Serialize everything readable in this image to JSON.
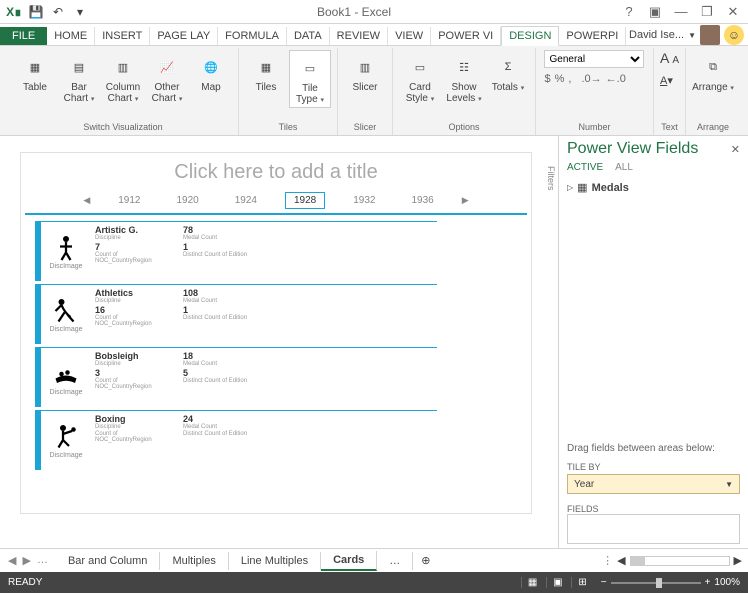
{
  "window": {
    "title": "Book1 - Excel"
  },
  "tabs": {
    "file": "FILE",
    "items": [
      "HOME",
      "INSERT",
      "PAGE LAY",
      "FORMULA",
      "DATA",
      "REVIEW",
      "VIEW",
      "POWER VI",
      "DESIGN",
      "POWERPI"
    ],
    "active": "DESIGN",
    "user": "David Ise..."
  },
  "ribbon": {
    "switchVis": {
      "label": "Switch Visualization",
      "btns": [
        "Table",
        "Bar Chart",
        "Column Chart",
        "Other Chart",
        "Map"
      ]
    },
    "tiles": {
      "label": "Tiles",
      "btns": [
        "Tiles",
        "Tile Type"
      ]
    },
    "slicer": {
      "label": "Slicer",
      "btn": "Slicer"
    },
    "options": {
      "label": "Options",
      "btns": [
        "Card Style",
        "Show Levels",
        "Totals"
      ]
    },
    "number": {
      "label": "Number",
      "format": "General"
    },
    "text": {
      "label": "Text"
    },
    "arrange": {
      "label": "Arrange",
      "btn": "Arrange"
    }
  },
  "canvas": {
    "titlePlaceholder": "Click here to add a title",
    "years": [
      "1912",
      "1920",
      "1924",
      "1928",
      "1932",
      "1936"
    ],
    "selectedYear": "1928",
    "filters": "Filters",
    "cards": [
      {
        "disc": "Artistic G.",
        "medal": "78",
        "noc": "7",
        "ed": "1"
      },
      {
        "disc": "Athletics",
        "medal": "108",
        "noc": "16",
        "ed": "1"
      },
      {
        "disc": "Bobsleigh",
        "medal": "18",
        "noc": "3",
        "ed": "5"
      },
      {
        "disc": "Boxing",
        "medal": "24",
        "noc": "",
        "ed": ""
      }
    ],
    "labels": {
      "disc": "Discipline",
      "medal": "Medal Count",
      "noc": "Count of NOC_CountryRegion",
      "ed": "Distinct Count of Edition",
      "img": "DiscImage"
    }
  },
  "sidebar": {
    "title": "Power View Fields",
    "tabActive": "ACTIVE",
    "tabAll": "ALL",
    "tables": [
      "Medals"
    ],
    "hint": "Drag fields between areas below:",
    "tileBy": "TILE BY",
    "tileField": "Year",
    "fields": "FIELDS"
  },
  "sheets": {
    "tabs": [
      "Bar and Column",
      "Multiples",
      "Line Multiples",
      "Cards"
    ],
    "active": "Cards"
  },
  "status": {
    "ready": "READY",
    "zoom": "100%"
  }
}
